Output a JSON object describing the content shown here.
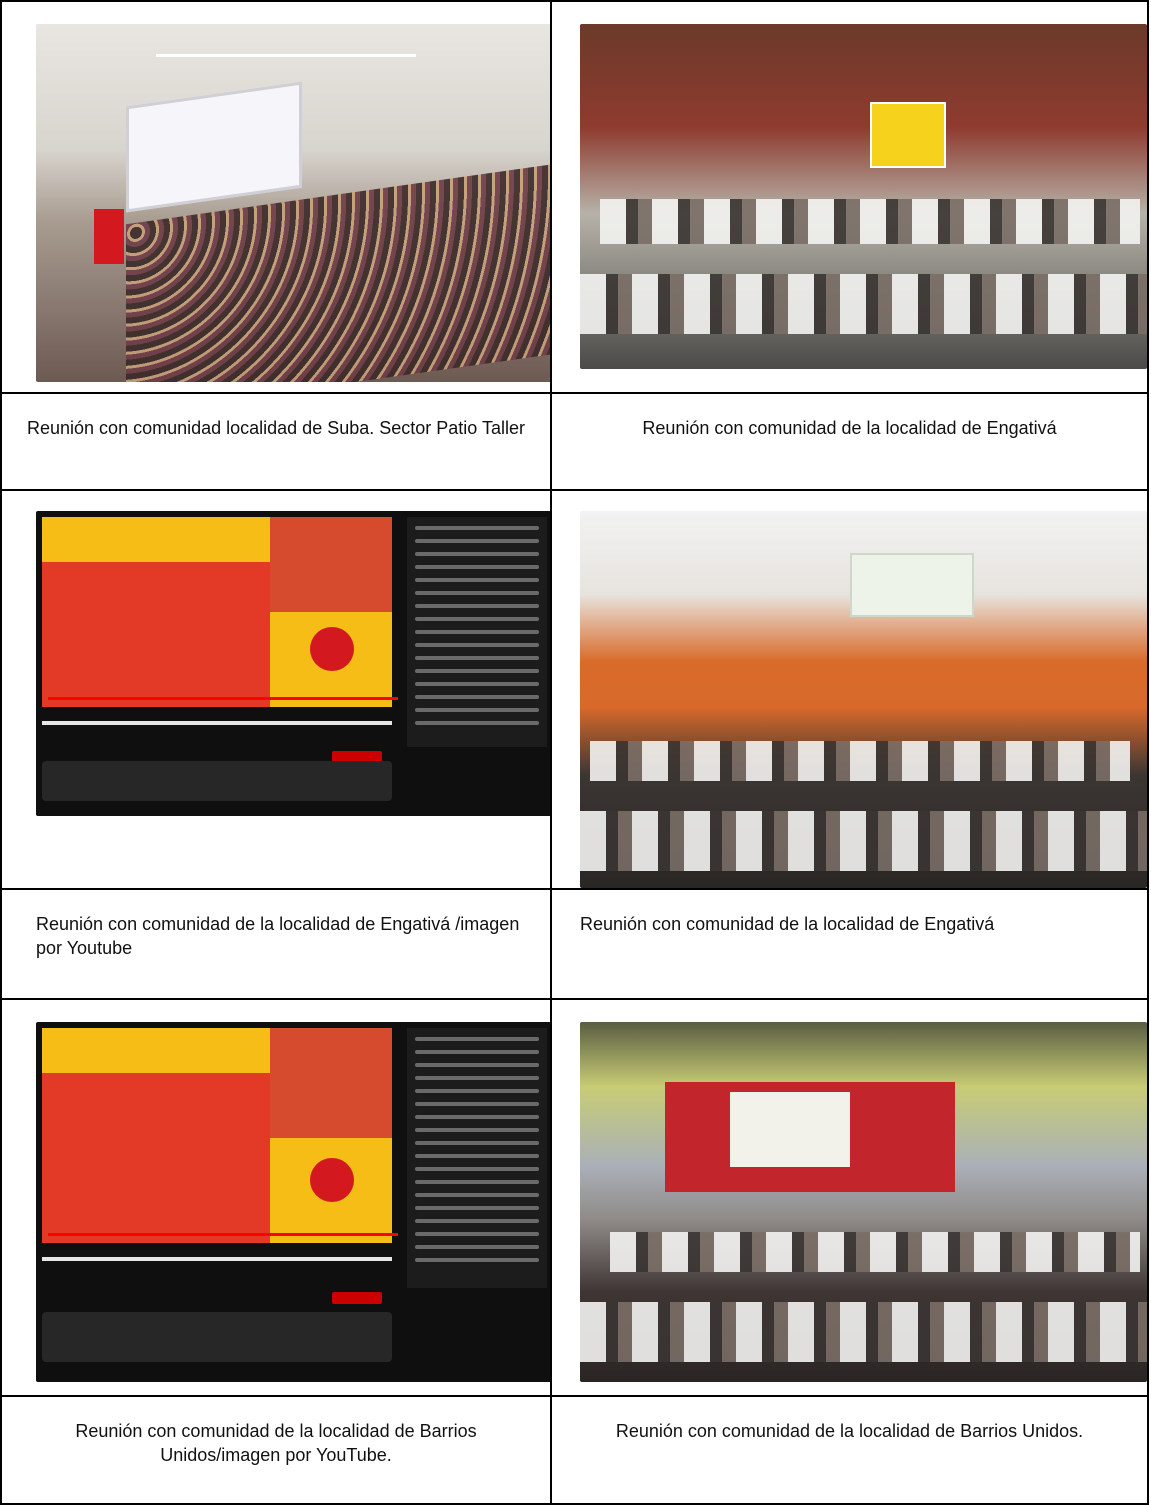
{
  "rows": [
    {
      "left": {
        "photo": "Auditorium meeting photo",
        "caption": "Reunión con comunidad localidad de Suba. Sector Patio Taller"
      },
      "right": {
        "photo": "Community hall meeting photo",
        "caption": "Reunión con comunidad de la localidad de Engativá"
      }
    },
    {
      "left": {
        "photo": "YouTube livestream screenshot",
        "caption": "Reunión con comunidad de la localidad de Engativá /imagen por Youtube"
      },
      "right": {
        "photo": "Community hall meeting photo",
        "caption": "Reunión con comunidad de la localidad de Engativá"
      }
    },
    {
      "left": {
        "photo": "YouTube livestream screenshot",
        "caption": "Reunión con comunidad de la localidad de Barrios Unidos/imagen por YouTube."
      },
      "right": {
        "photo": "Community hall meeting photo",
        "caption": "Reunión con comunidad de la localidad de Barrios Unidos."
      }
    }
  ]
}
